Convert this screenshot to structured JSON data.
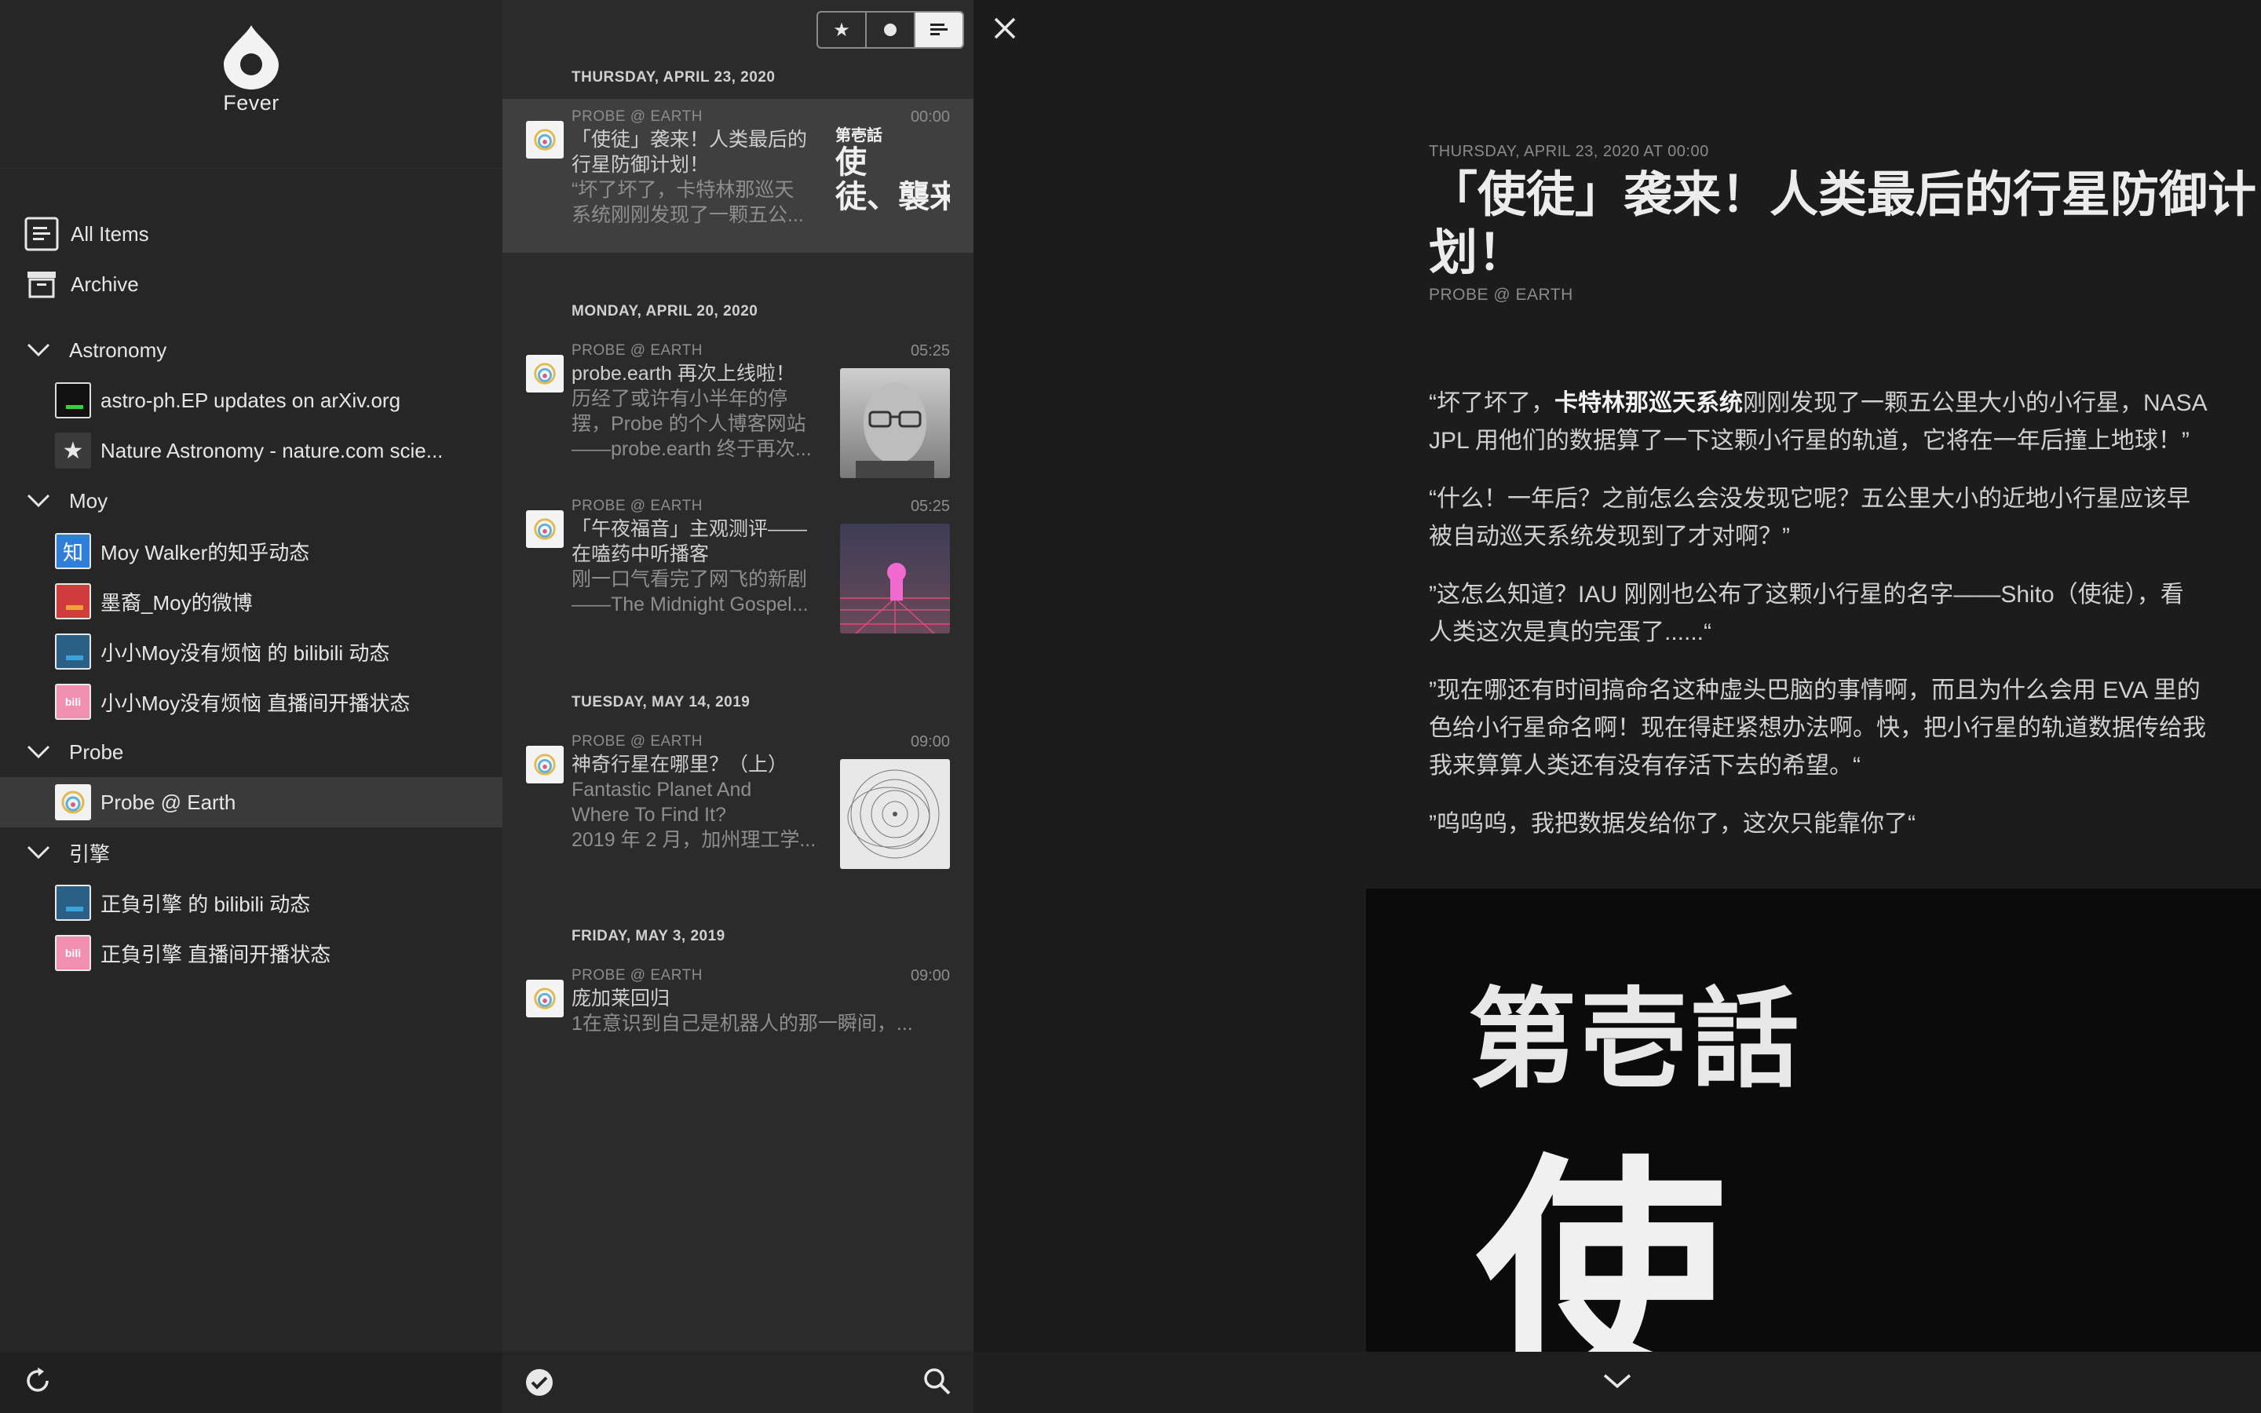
{
  "app": {
    "name": "Fever"
  },
  "sidebar": {
    "top_items": [
      {
        "label": "All Items",
        "icon": "all-items-icon"
      },
      {
        "label": "Archive",
        "icon": "archive-icon"
      }
    ],
    "groups": [
      {
        "label": "Astronomy",
        "feeds": [
          {
            "label": "astro-ph.EP updates on arXiv.org"
          },
          {
            "label": "Nature Astronomy - nature.com scie..."
          }
        ]
      },
      {
        "label": "Moy",
        "feeds": [
          {
            "label": "Moy Walker的知乎动态",
            "icon_text": "知"
          },
          {
            "label": "墨裔_Moy的微博"
          },
          {
            "label": "小小Moy没有烦恼 的 bilibili 动态"
          },
          {
            "label": "小小Moy没有烦恼 直播间开播状态",
            "icon_text": "bili"
          }
        ]
      },
      {
        "label": "Probe",
        "feeds": [
          {
            "label": "Probe @ Earth"
          }
        ]
      },
      {
        "label": "引擎",
        "feeds": [
          {
            "label": "正負引擎 的 bilibili 动态"
          },
          {
            "label": "正負引擎 直播间开播状态",
            "icon_text": "bili"
          }
        ]
      }
    ]
  },
  "list": {
    "filters": [
      "starred",
      "unread",
      "all"
    ],
    "sections": [
      {
        "date": "THURSDAY, APRIL 23, 2020"
      },
      {
        "date": "MONDAY, APRIL 20, 2020"
      },
      {
        "date": "TUESDAY, MAY 14, 2019"
      },
      {
        "date": "FRIDAY, MAY 3, 2019"
      }
    ],
    "articles": [
      {
        "source": "PROBE @ EARTH",
        "time": "00:00",
        "title1": "「使徒」袭来！人类最后的",
        "title2": "行星防御计划！",
        "excerpt1": "“坏了坏了，卡特林那巡天",
        "excerpt2": "系统刚刚发现了一颗五公...",
        "thumb_line1": "第壱話",
        "thumb_line2": "使",
        "thumb_line3": "徒、襲来"
      },
      {
        "source": "PROBE @ EARTH",
        "time": "05:25",
        "title1": "probe.earth 再次上线啦！",
        "excerpt1": "历经了或许有小半年的停",
        "excerpt2": "摆，Probe 的个人博客网站",
        "excerpt3": "——probe.earth 终于再次..."
      },
      {
        "source": "PROBE @ EARTH",
        "time": "05:25",
        "title1": "「午夜福音」主观测评——",
        "title2": "在嗑药中听播客",
        "excerpt1": "刚一口气看完了网飞的新剧",
        "excerpt2": "——The Midnight Gospel..."
      },
      {
        "source": "PROBE @ EARTH",
        "time": "09:00",
        "title1": "神奇行星在哪里？（上）",
        "excerpt1": "Fantastic Planet And",
        "excerpt2": "Where To Find It?",
        "excerpt3": "2019 年 2 月，加州理工学..."
      },
      {
        "source": "PROBE @ EARTH",
        "time": "09:00",
        "title1": "庞加莱回归",
        "excerpt1": "1在意识到自己是机器人的那一瞬间，..."
      }
    ]
  },
  "reader": {
    "dateline": "THURSDAY, APRIL 23, 2020 AT 00:00",
    "title": "「使徒」袭来！人类最后的行星防御计划！",
    "source": "PROBE @ EARTH",
    "p1_a": "“坏了坏了，",
    "p1_b": "卡特林那巡天系统",
    "p1_c": "刚刚发现了一颗五公里大小的小行星，NASA",
    "p1_d": "JPL 用他们的数据算了一下这颗小行星的轨道，它将在一年后撞上地球！”",
    "p2_a": "“什么！一年后？之前怎么会没发现它呢？五公里大小的近地小行星应该早",
    "p2_b": "被自动巡天系统发现到了才对啊？”",
    "p3_a": "”这怎么知道？IAU 刚刚也公布了这颗小行星的名字——Shito（使徒），看",
    "p3_b": "人类这次是真的完蛋了......“",
    "p4_a": "”现在哪还有时间搞命名这种虚头巴脑的事情啊，而且为什么会用 EVA 里的",
    "p4_b": "色给小行星命名啊！现在得赶紧想办法啊。快，把小行星的轨道数据传给我",
    "p4_c": "我来算算人类还有没有存活下去的希望。“",
    "p5": "”呜呜呜，我把数据发给你了，这次只能靠你了“",
    "image_line1": "第壱話",
    "image_line2": "使"
  }
}
